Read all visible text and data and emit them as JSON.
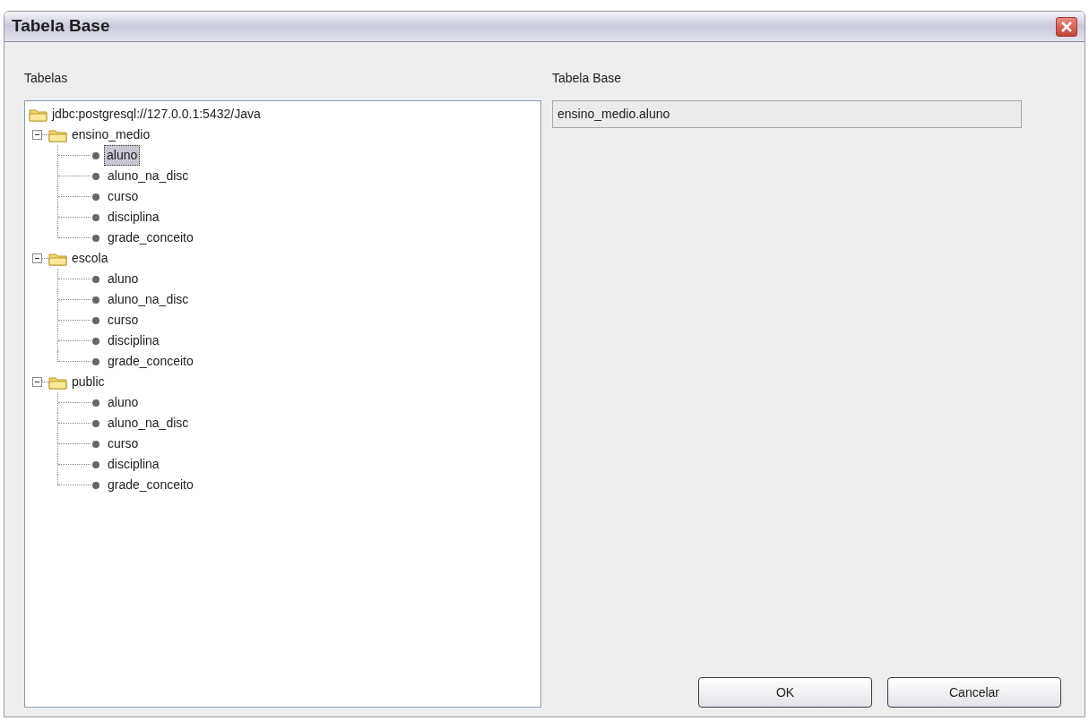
{
  "window": {
    "title": "Tabela Base"
  },
  "tree_label": "Tabelas",
  "tree": {
    "label": "jdbc:postgresql://127.0.0.1:5432/Java",
    "children": [
      {
        "label": "ensino_medio",
        "expanded": true,
        "children": [
          {
            "label": "aluno",
            "selected": true
          },
          {
            "label": "aluno_na_disc",
            "selected": false
          },
          {
            "label": "curso",
            "selected": false
          },
          {
            "label": "disciplina",
            "selected": false
          },
          {
            "label": "grade_conceito",
            "selected": false
          }
        ]
      },
      {
        "label": "escola",
        "expanded": true,
        "children": [
          {
            "label": "aluno",
            "selected": false
          },
          {
            "label": "aluno_na_disc",
            "selected": false
          },
          {
            "label": "curso",
            "selected": false
          },
          {
            "label": "disciplina",
            "selected": false
          },
          {
            "label": "grade_conceito",
            "selected": false
          }
        ]
      },
      {
        "label": "public",
        "expanded": true,
        "children": [
          {
            "label": "aluno",
            "selected": false
          },
          {
            "label": "aluno_na_disc",
            "selected": false
          },
          {
            "label": "curso",
            "selected": false
          },
          {
            "label": "disciplina",
            "selected": false
          },
          {
            "label": "grade_conceito",
            "selected": false
          }
        ]
      }
    ]
  },
  "base_table": {
    "label": "Tabela Base",
    "value": "ensino_medio.aluno"
  },
  "buttons": [
    "OK",
    "Cancelar"
  ]
}
